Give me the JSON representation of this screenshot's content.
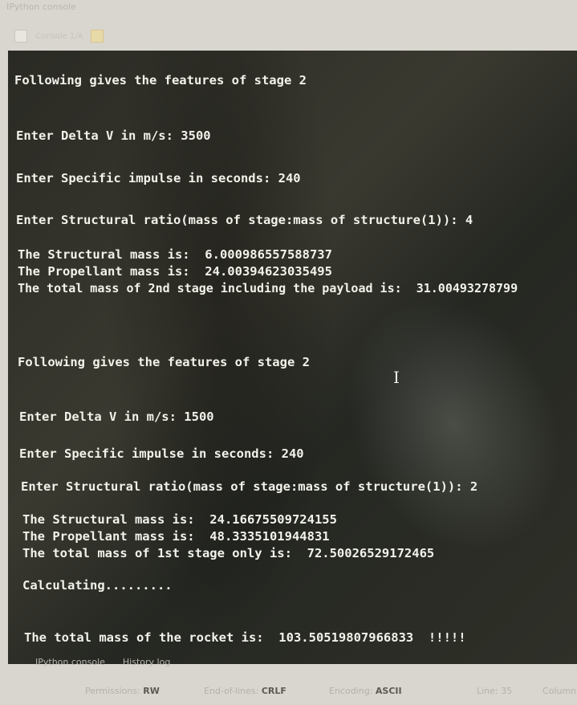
{
  "pane_title": "IPython console",
  "toolbar": {
    "console_tab": "Console 1/A"
  },
  "console": {
    "lines": [
      "Following gives the features of stage 2",
      "Enter Delta V in m/s: 3500",
      "Enter Specific impulse in seconds: 240",
      "Enter Structural ratio(mass of stage:mass of structure(1)): 4",
      "The Structural mass is:  6.000986557588737",
      "The Propellant mass is:  24.00394623035495",
      "The total mass of 2nd stage including the payload is:  31.00493278799",
      "Following gives the features of stage 2",
      "Enter Delta V in m/s: 1500",
      "Enter Specific impulse in seconds: 240",
      "Enter Structural ratio(mass of stage:mass of structure(1)): 2",
      "The Structural mass is:  24.16675509724155",
      "The Propellant mass is:  48.3335101944831",
      "The total mass of 1st stage only is:  72.50026529172465",
      "Calculating.........",
      "The total mass of the rocket is:  103.50519807966833  !!!!!"
    ]
  },
  "bottom_tabs": [
    "IPython console",
    "History log"
  ],
  "status_bar": {
    "permissions_label": "Permissions:",
    "permissions_value": "RW",
    "eol_label": "End-of-lines:",
    "eol_value": "CRLF",
    "encoding_label": "Encoding:",
    "encoding_value": "ASCII",
    "line_label": "Line:",
    "line_value": "35",
    "column_label": "Column"
  }
}
